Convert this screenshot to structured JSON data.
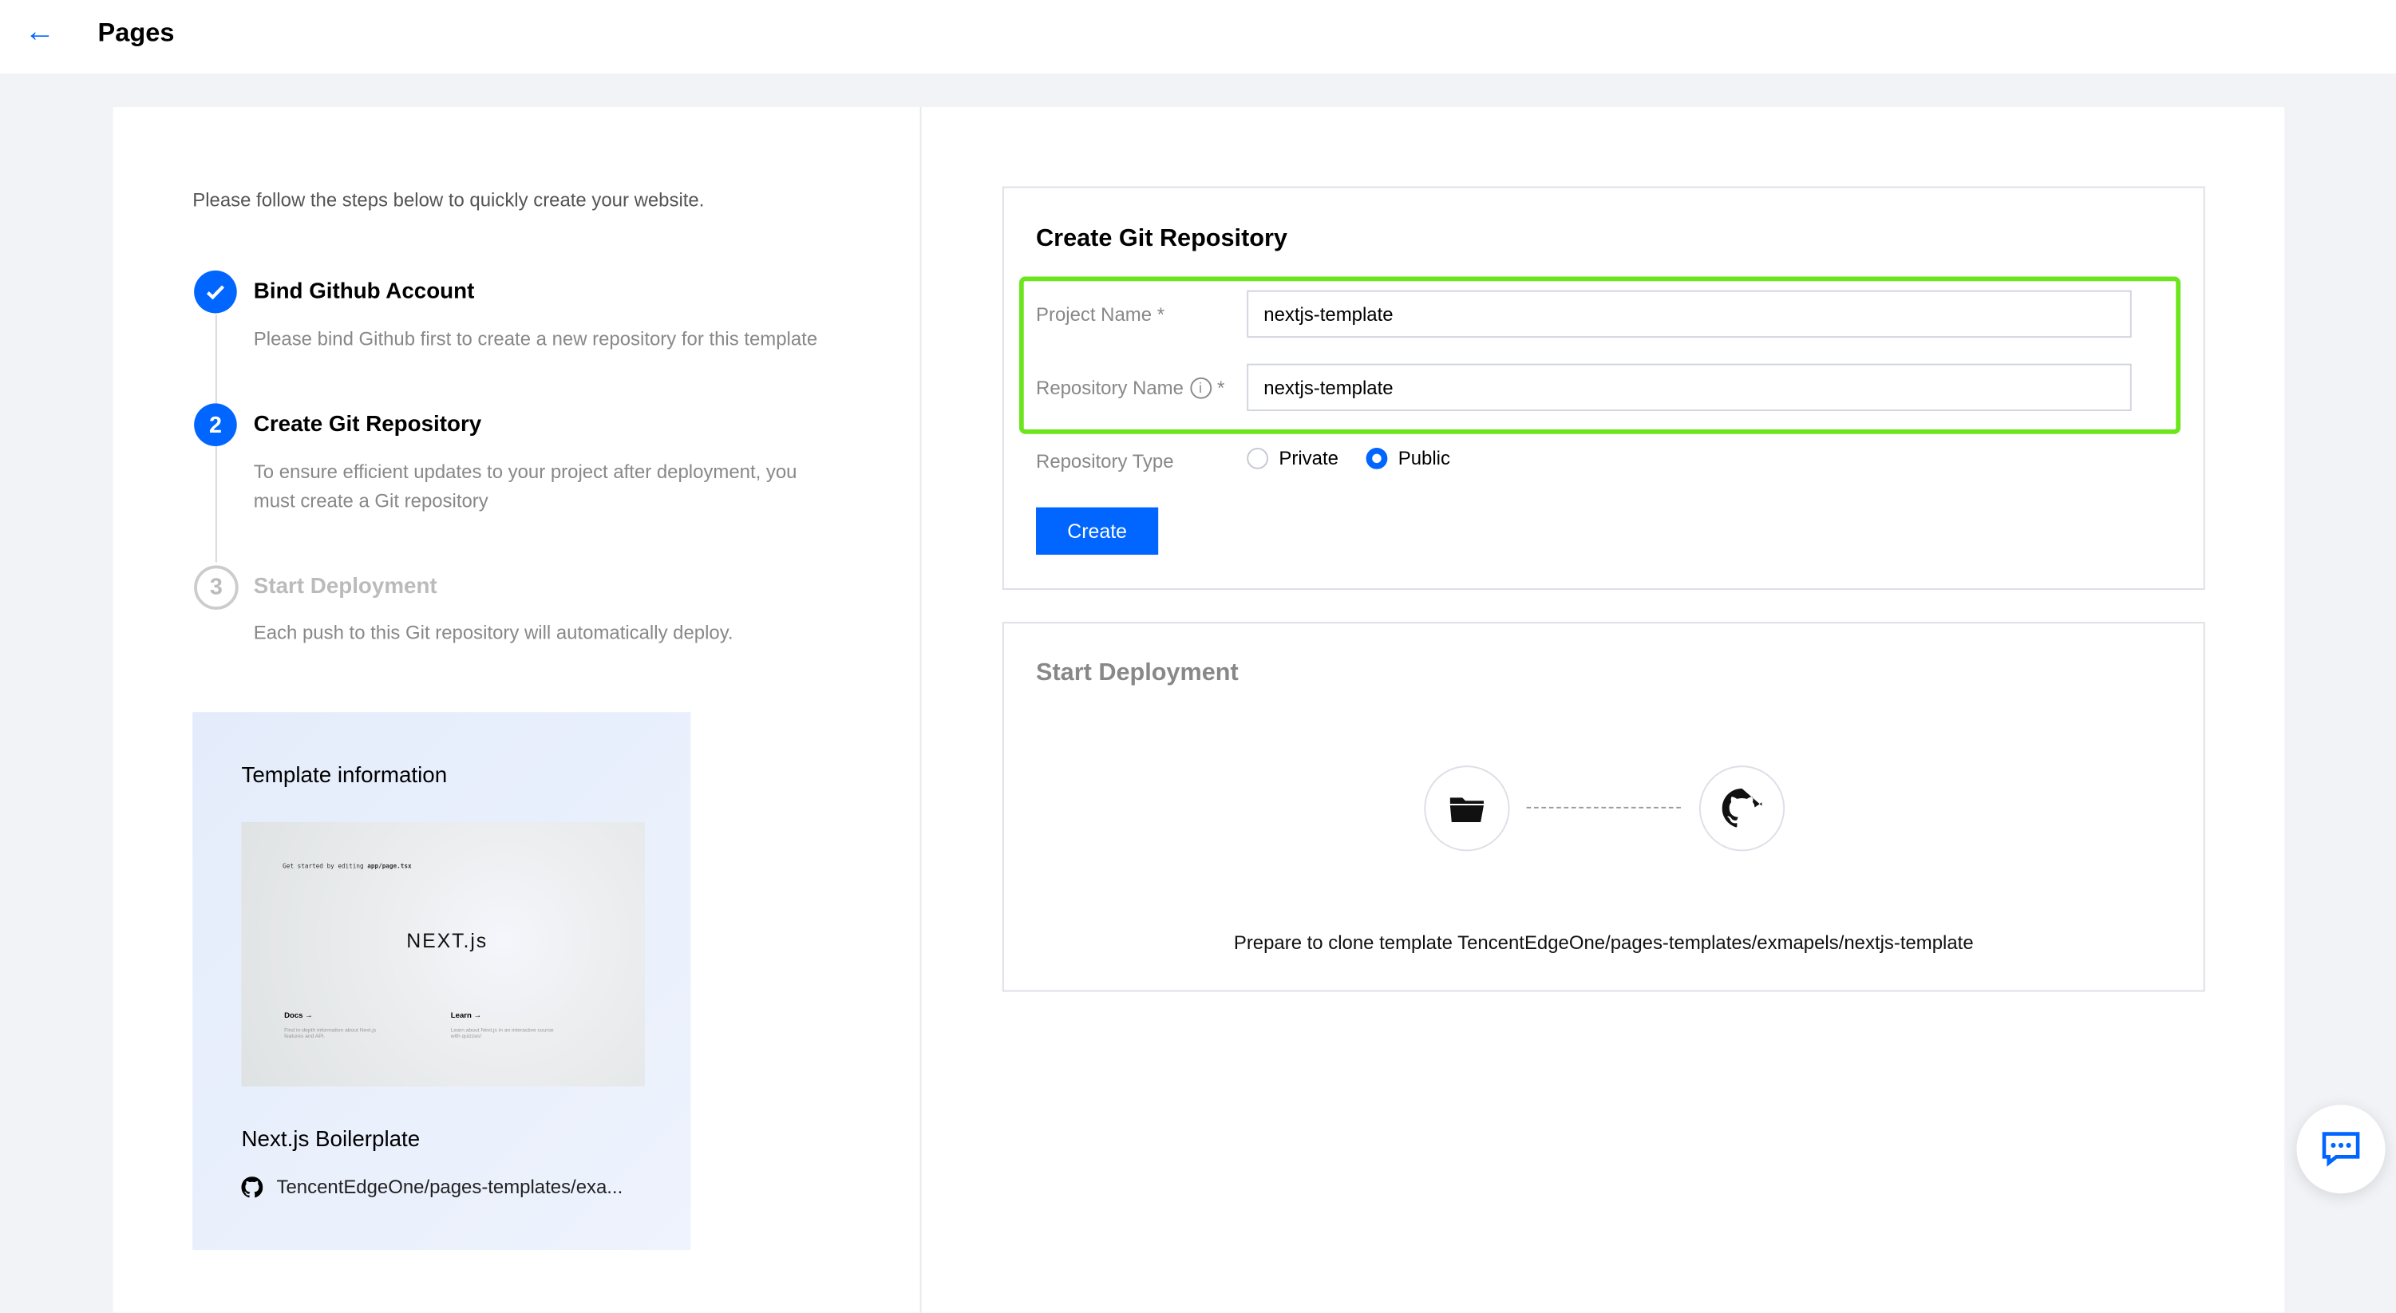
{
  "header": {
    "title": "Pages",
    "back_icon": "arrow-left-icon"
  },
  "intro": "Please follow the steps below to quickly create your website.",
  "steps": [
    {
      "number": "1",
      "state": "done",
      "title": "Bind Github Account",
      "desc": "Please bind Github first to create a new repository for this template"
    },
    {
      "number": "2",
      "state": "current",
      "title": "Create Git Repository",
      "desc": "To ensure efficient updates to your project after deployment, you must create a Git repository"
    },
    {
      "number": "3",
      "state": "todo",
      "title": "Start Deployment",
      "desc": "Each push to this Git repository will automatically deploy."
    }
  ],
  "template": {
    "heading": "Template information",
    "preview": {
      "hint": "Get started by editing",
      "file": "app/page.tsx",
      "logo": "NEXT.js",
      "docs": "Docs →",
      "docs_desc": "Find in-depth information about Next.js features and API.",
      "learn": "Learn →",
      "learn_desc": "Learn about Next.js in an interactive course with quizzes!"
    },
    "name": "Next.js Boilerplate",
    "repo": "TencentEdgeOne/pages-templates/exa..."
  },
  "create_panel": {
    "title": "Create Git Repository",
    "project_name_label": "Project Name",
    "project_name_value": "nextjs-template",
    "repo_name_label": "Repository Name",
    "repo_name_value": "nextjs-template",
    "required_mark": "*",
    "repo_type_label": "Repository Type",
    "options": [
      "Private",
      "Public"
    ],
    "selected": "Public",
    "create_button": "Create",
    "highlight_color": "#6be51c"
  },
  "deploy_panel": {
    "title": "Start Deployment",
    "message": "Prepare to clone template TencentEdgeOne/pages-templates/exmapels/nextjs-template"
  },
  "colors": {
    "primary": "#0066ff",
    "background": "#f2f3f7"
  }
}
